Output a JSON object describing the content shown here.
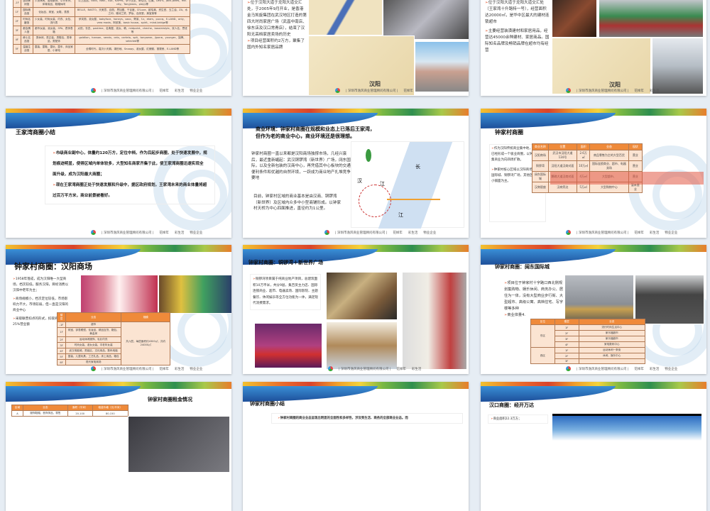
{
  "footer": {
    "company": "| 深圳市逸风商业管理顾问有限公司 |",
    "brand1": "花样年",
    "brand2": "彩生活",
    "brand3": "物业企业"
  },
  "s1": {
    "rows": [
      [
        "-1F",
        "运动休闲馆",
        "少男休闲、运动服饰、牛仔系列、体育用品、鞋帽休闲",
        "以上品品、coco、NIKE、ADI、KAPPA、李宁比亚、哥伦比、匹威、Levi's、Jack-Jones、me-city、Tonyjeans、playy等"
      ],
      [
        "1F",
        "国际精品馆",
        "化妆品、珠宝、女鞋、表表",
        "BELLE、BASTO、天美意、百丽、思加图、千百度、D'Luxe、欧珀莱、资生堂、玉兰油、ZA、水之印、雅诗兰黛、梦妆、自然堂、美宝莲等"
      ],
      [
        "2F",
        "时尚名媛馆",
        "少女装、时尚女装、内衣、女包、流行表",
        "伊芙丽、淑女屋、babyface、honeys、ozoc、哥弟、f.z、etam、puccq、E-LAND、only、vero moda、阿依莲、basic house、spirit、mind-bridge等"
      ],
      [
        "3F",
        "都会情人馆",
        "都市女装、淑女装、SPA、表饰表箱",
        "太阳、衣恋、pastime、名典屋、淑女、韩、midpoint、cheche、bossinistyle、双人名、思班等"
      ],
      [
        "4F",
        "绅士名品馆",
        "男休闲、男正装、男鞋包、男单品、男配饰",
        "goldlion、hanson、sendo、celo、cartelo、spit、tonywear、jipone、younger、柒牌、selected等"
      ],
      [
        "5F",
        "温馨生活馆",
        "童装、童鞋、童玩、童车、床品家居、小家电",
        "全棉时代、嘉贝小天鹅、湖田地、Snoopy、淑女屋、红蜻蜓、丽婴房、E-LAND等"
      ]
    ]
  },
  "s2": {
    "bullets": [
      "位于汉阳大道于龙阳大道交汇处，于2005年9月开业，是香港金马凯旋集团在武汉地区打造的第四大时尚家居广场（武昌中南店、徐东店及汉口常青店），结束了汉阳无高档家居卖场的历史",
      "项目经营面积约2万方，聚集了国内外知名家居品牌"
    ],
    "map_label": "汉阳"
  },
  "s3": {
    "bullets": [
      "位于汉阳大道于龙阳大道交汇处（王家湾十升路特一号），经营面积达20000㎡，是华中区最大的建材连锁超市",
      "主要经营装潢建材和家居用品，经营达45000余种建材、家居商品。国际知名品牌及畅销品牌在超市均有经营"
    ],
    "map_label": "汉阳"
  },
  "s4": {
    "title": "王家湾商圈小结",
    "bullets": [
      "市级商业副中心，体量约120万方，定位中档，作为后起步商圈，处于快速发展中，规划痕迹明显，使得区域内单体较多，大型知名商家齐集于此，使王家湾商圈迅速实现全面升级，成为汉阳最大商圈；",
      "现在王家湾商圈正处于快速发展和升级中，据区政府规划，王家湾未来的商业体量将超过百万平方米，商业前景被看好。"
    ]
  },
  "s5": {
    "title1": "商业环境：钟家村商圈在规模和业态上已落后王家湾，",
    "title2": "但作为老的商业中心，商业环境还是很理想。",
    "p1": "钟家村商圈一直以来都是汉阳商场独撑市场，几经兴衰后，最近重新崛起：武汉铜锣湾（新世界）广场，阔东国际，以及全新包装的汉商中心，再凭借其中心板块的交通便利条件和优越的自然环境，一跃成为商业地产扎堆竞争要地",
    "p2": "目前，钟家村区域的商业基本是由汉商、铜锣湾（新世界）及区域内众多中小型商铺形成。以钟家村天桥为中心四面推进，直径约为1公里。",
    "map_labels": [
      "长",
      "汉",
      "江",
      "江"
    ]
  },
  "s6": {
    "title": "钟家村商圈",
    "bullets": [
      "作为汉阳传统商业集中地，钟家村已经形成一个极业商圈，以钟家村密集商业为向四周扩散。",
      "钟家村核心区域以汉阳商场、阔东国际城、铜锣湾广场，其他区域以中小铺面为主。"
    ],
    "headers": [
      "商业名称",
      "位置",
      "面积",
      "业态",
      "现状"
    ],
    "rows": [
      [
        "汉阳商场",
        "武汉市汉阳大道134号",
        "2.6万㎡",
        "商品零售为主的大型百货",
        "营业"
      ],
      [
        "铜锣湾",
        "汉阳大道汉商对面",
        "10万㎡",
        "国际连锁商业、超市、电器卖场",
        "营业"
      ],
      [
        "阔东国际城",
        "鹦鹉大道汉商对面",
        "4万㎡",
        "大型超市、",
        "营业"
      ],
      [
        "汉商银座",
        "汉商旁边",
        "5万㎡",
        "大型购物中心",
        "暂未营业"
      ]
    ]
  },
  "s7": {
    "title": "钟家村商圈：汉阳商场",
    "bullets": [
      "1958年落成，成为汉阳唯一大型商场，档次较低，服务汉阳，目标消费以汉阳中老年为主；",
      "商场规模小，档次定位较低，市场影响力不大，市场较弱，但一直是汉阳的商业中心",
      "采取联营扣点的形式，扣取商家10-25%营业额"
    ],
    "headers": [
      "楼层",
      "业态",
      "规模"
    ],
    "rows": [
      [
        "-1F",
        "超市"
      ],
      [
        "1F",
        "珠宝、钟表眼镜、化妆品、精品百货、箱包、黄金房"
      ],
      [
        "2F",
        "运动休闲服饰、毛衫内衣"
      ],
      [
        "3F",
        "时尚女装、淑女女装、中老年女装"
      ],
      [
        "4F",
        "武汉电脑城、男装区、文化用品、数码电脑"
      ],
      [
        "5F",
        "童装、儿童玩具、工艺礼品、床上用品、箱包"
      ],
      [
        "6F",
        "现代家电商场"
      ]
    ],
    "scale": "共六层，每层面积约4300㎡，共约24000㎡"
  },
  "s8": {
    "title": "钟家村商圈：铜锣湾＋新世界广场",
    "bullets": [
      "铜锣湾项目属于纯商业地产项目，总建筑面积10万平米，共分9层，集百货主力店、国际连锁商业、超市、电器卖场、国际影院、主题餐饮、休闲娱乐等全方位功能为一体，满足现代消费需求。"
    ]
  },
  "s9": {
    "title": "钟家村商圈：阔东国际城",
    "bullets": [
      "项目位于钟家村十字路口西北侧规划集购物、娱乐休闲、商务办公、居住为一体，没有大型商业步行街、大型超市、高级公寓、高档住宅、写字楼等多种",
      "商业体量4."
    ],
    "headers": [
      "区位",
      "楼层",
      "业态"
    ],
    "rows": [
      [
        "东区",
        "1F",
        "流行时尚生活中心"
      ],
      [
        "",
        "2F",
        "家乐福超市"
      ],
      [
        "",
        "3F",
        "家乐福超市"
      ],
      [
        "",
        "4F",
        "家电数码中心"
      ],
      [
        "西区",
        "1F",
        "运动休闲一条街"
      ],
      [
        "",
        "2F",
        "休闲、娱乐中心"
      ],
      [
        "",
        "3F",
        ""
      ]
    ]
  },
  "s10": {
    "title": "钟家村商圈租金情况",
    "headers": [
      "区域",
      "业态",
      "面积（平米）",
      "租金价格（元/平米）"
    ],
    "rows": [
      [
        "A",
        "服饰鞋帽、首饰饰品、零售",
        "20-100",
        "80-150"
      ]
    ]
  },
  "s11": {
    "title": "钟家村商圈小结",
    "bullets": [
      "钟家村商圈的商业业态呈现出明显的全面性和多样性，涉及到生活、商务的全部商业业态。而"
    ]
  },
  "s12": {
    "title": "汉口商圈：经开万达",
    "bullets": [
      "商业面积22.3万方；"
    ]
  }
}
